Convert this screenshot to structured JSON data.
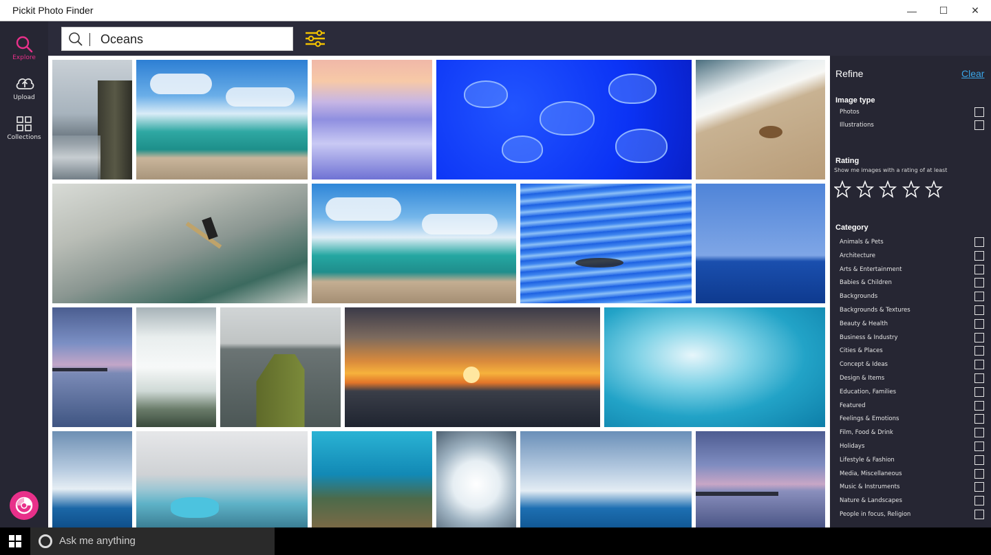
{
  "window": {
    "title": "Pickit Photo Finder",
    "minimize": "—",
    "maximize": "☐",
    "close": "✕"
  },
  "rail": {
    "explore_label": "Explore",
    "upload_label": "Upload",
    "collections_label": "Collections",
    "accent": "#e8308a"
  },
  "search": {
    "value": "Oceans"
  },
  "refine": {
    "title": "Refine",
    "clear_label": "Clear",
    "image_type_heading": "Image type",
    "image_types": [
      "Photos",
      "Illustrations"
    ],
    "rating_heading": "Rating",
    "rating_sub": "Show me images with a rating of at least",
    "rating_value": 0,
    "rating_max": 5,
    "category_heading": "Category",
    "categories": [
      "Animals & Pets",
      "Architecture",
      "Arts & Entertainment",
      "Babies & Children",
      "Backgrounds",
      "Backgrounds & Textures",
      "Beauty & Health",
      "Business & Industry",
      "Cities & Places",
      "Concept & Ideas",
      "Design & Items",
      "Education, Families",
      "Featured",
      "Feelings & Emotions",
      "Film, Food & Drink",
      "Holidays",
      "Lifestyle & Fashion",
      "Media, Miscellaneous",
      "Music & Instruments",
      "Nature & Landscapes",
      "People in focus, Religion"
    ]
  },
  "images": [
    "sea-cliff",
    "beach-blue-sky",
    "sunset-waves",
    "jellyfish",
    "crab-on-sand",
    "surfer",
    "beach-clouds",
    "seagull-landing",
    "deep-blue-horizon",
    "pier-dusk",
    "waterfall",
    "stone-jetty",
    "sunset-birds",
    "turquoise-wave",
    "offshore-wind",
    "icebergs",
    "reef-underwater",
    "wave-splash",
    "wind-farm-wide",
    "pier-purple"
  ],
  "taskbar": {
    "search_placeholder": "Ask me anything"
  }
}
